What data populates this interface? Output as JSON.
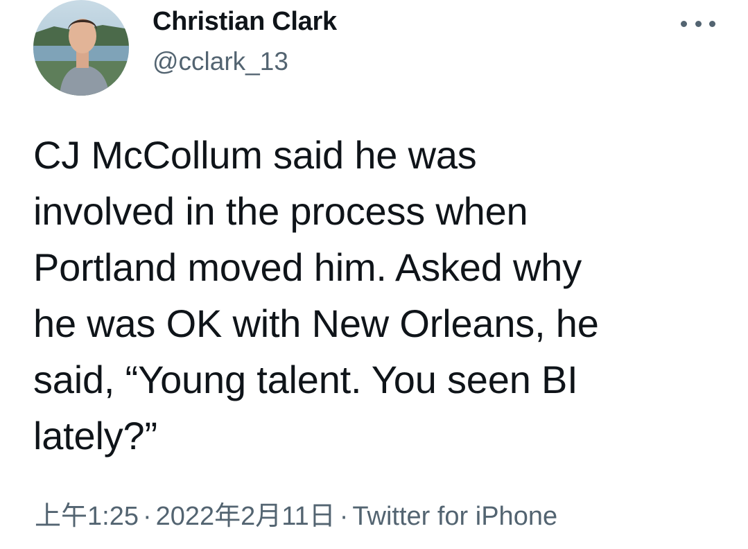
{
  "author": {
    "display_name": "Christian Clark",
    "handle": "@cclark_13",
    "avatar_icon": "profile-photo"
  },
  "menu": {
    "icon": "more-horizontal-icon"
  },
  "tweet": {
    "lines": [
      "CJ McCollum said he was",
      "involved in the process when",
      "Portland moved him. Asked why",
      "he was OK with New Orleans, he",
      "said, “Young talent. You seen BI",
      "lately?”"
    ]
  },
  "meta": {
    "time": "上午1:25",
    "separator": "·",
    "date": "2022年2月11日",
    "source": "Twitter for iPhone"
  },
  "colors": {
    "text_primary": "#0f1419",
    "text_secondary": "#536471",
    "background": "#ffffff"
  }
}
